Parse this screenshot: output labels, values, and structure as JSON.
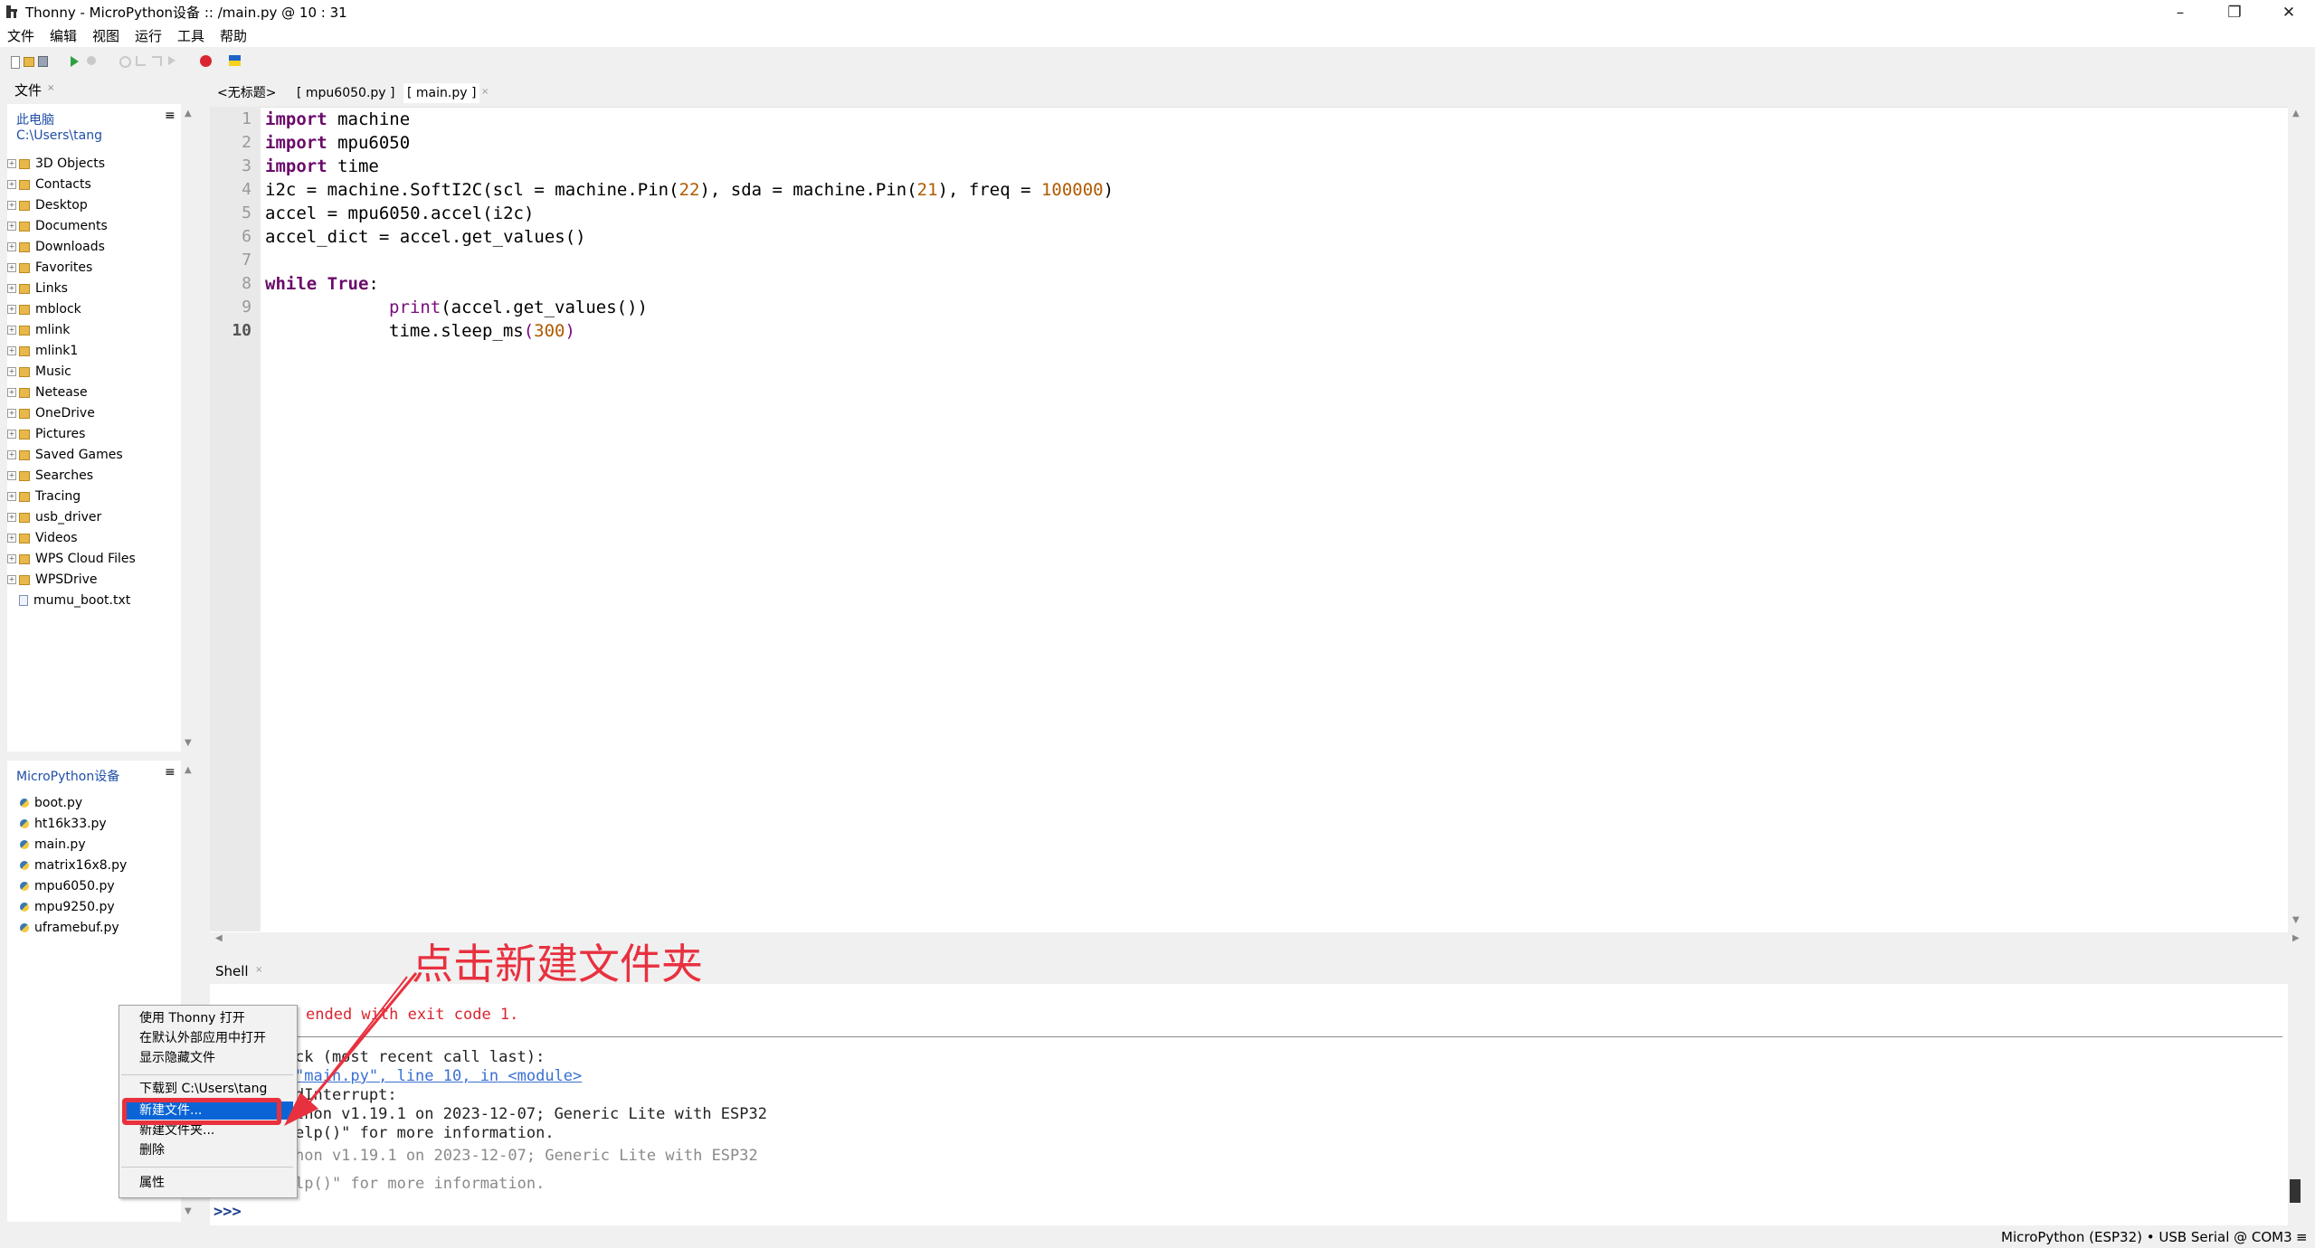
{
  "window": {
    "title": "Thonny  -  MicroPython设备 :: /main.py  @  10 : 31",
    "minimize": "–",
    "restore": "❐",
    "close": "✕"
  },
  "menu": [
    "文件",
    "编辑",
    "视图",
    "运行",
    "工具",
    "帮助"
  ],
  "files_pane": {
    "tab": "文件",
    "computer_label": "此电脑",
    "computer_path": "C:\\Users\\tang",
    "local_items": [
      {
        "name": "3D Objects",
        "type": "folder"
      },
      {
        "name": "Contacts",
        "type": "folder"
      },
      {
        "name": "Desktop",
        "type": "folder"
      },
      {
        "name": "Documents",
        "type": "folder"
      },
      {
        "name": "Downloads",
        "type": "folder"
      },
      {
        "name": "Favorites",
        "type": "folder"
      },
      {
        "name": "Links",
        "type": "folder"
      },
      {
        "name": "mblock",
        "type": "folder"
      },
      {
        "name": "mlink",
        "type": "folder"
      },
      {
        "name": "mlink1",
        "type": "folder"
      },
      {
        "name": "Music",
        "type": "folder"
      },
      {
        "name": "Netease",
        "type": "folder"
      },
      {
        "name": "OneDrive",
        "type": "folder"
      },
      {
        "name": "Pictures",
        "type": "folder"
      },
      {
        "name": "Saved Games",
        "type": "folder"
      },
      {
        "name": "Searches",
        "type": "folder"
      },
      {
        "name": "Tracing",
        "type": "folder"
      },
      {
        "name": "usb_driver",
        "type": "folder"
      },
      {
        "name": "Videos",
        "type": "folder"
      },
      {
        "name": "WPS Cloud Files",
        "type": "folder"
      },
      {
        "name": "WPSDrive",
        "type": "folder"
      },
      {
        "name": "mumu_boot.txt",
        "type": "file"
      }
    ],
    "device_label": "MicroPython设备",
    "device_items": [
      "boot.py",
      "ht16k33.py",
      "main.py",
      "matrix16x8.py",
      "mpu6050.py",
      "mpu9250.py",
      "uframebuf.py"
    ]
  },
  "editor": {
    "tabs": [
      "<无标题>",
      "[ mpu6050.py ]",
      "[ main.py ]"
    ],
    "line_numbers": [
      "1",
      "2",
      "3",
      "4",
      "5",
      "6",
      "7",
      "8",
      "9",
      "10"
    ]
  },
  "code": {
    "l1_kw": "import",
    "l1_rest": " machine",
    "l2_kw": "import",
    "l2_rest": " mpu6050",
    "l3_kw": "import",
    "l3_rest": " time",
    "l4_a": "i2c = machine.SoftI2C(scl = machine.Pin(",
    "l4_n1": "22",
    "l4_b": "), sda = machine.Pin(",
    "l4_n2": "21",
    "l4_c": "), freq = ",
    "l4_n3": "100000",
    "l4_d": ")",
    "l5": "accel = mpu6050.accel(i2c)",
    "l6": "accel_dict = accel.get_values()",
    "l8_kw1": "while",
    "l8_kw2": "True",
    "l8_colon": ":",
    "l9_fn": "print",
    "l9_rest": "(accel.get_values())",
    "l10_a": "time.sleep_ms",
    "l10_p1": "(",
    "l10_n": "300",
    "l10_p2": ")"
  },
  "shell": {
    "tab": "Shell",
    "line1": "ended with exit code 1.",
    "line2": "ck (most recent call last):",
    "line3": "\"main.py\", line 10, in <module>",
    "line4": "dInterrupt:",
    "line5": "thon v1.19.1 on 2023-12-07; Generic Lite with ESP32",
    "line6": "elp()\" for more information.",
    "line7": "hon v1.19.1 on 2023-12-07; Generic Lite with ESP32",
    "line8": "lp()\" for more information.",
    "prompt": ">>>"
  },
  "context_menu": {
    "items": [
      "使用 Thonny 打开",
      "在默认外部应用中打开",
      "显示隐藏文件",
      "下载到 C:\\Users\\tang",
      "新建文件...",
      "新建文件夹...",
      "删除",
      "属性"
    ],
    "highlighted": "新建文件..."
  },
  "annotation": {
    "text": "点击新建文件夹",
    "color": "#e8313f"
  },
  "statusbar": {
    "text": "MicroPython (ESP32)  •  USB Serial @ COM3",
    "menu_icon": "≡"
  },
  "colors": {
    "accent_selection": "#0a64d6",
    "keyword": "#6a0a6a",
    "number": "#b05a00",
    "shell_error": "#d9252f"
  }
}
